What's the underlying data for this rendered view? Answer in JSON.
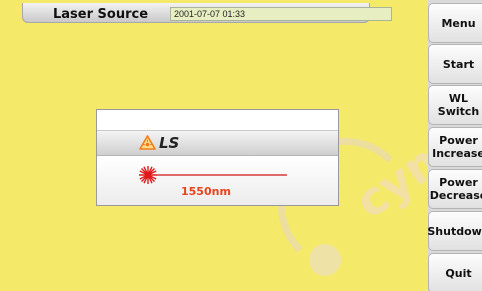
{
  "header": {
    "title": "Laser Source",
    "datetime": "2001-07-07 01:33"
  },
  "menu": {
    "items": [
      {
        "label": "Menu"
      },
      {
        "label": "Start"
      },
      {
        "label": "WL Switch"
      },
      {
        "label": "Power\nIncrease"
      },
      {
        "label": "Power\nDecrease"
      },
      {
        "label": "Shutdown"
      },
      {
        "label": "Quit"
      }
    ]
  },
  "dialog": {
    "source_label": "LS",
    "wavelength": "1550nm",
    "warning_icon": "laser-warning-icon",
    "laser_icon": "laser-emission-icon"
  },
  "colors": {
    "background": "#f5e96a",
    "wavelength_text": "#e8431c",
    "warning": "#f07d1a",
    "laser": "#e01818"
  },
  "watermark": {
    "text": "cym"
  }
}
